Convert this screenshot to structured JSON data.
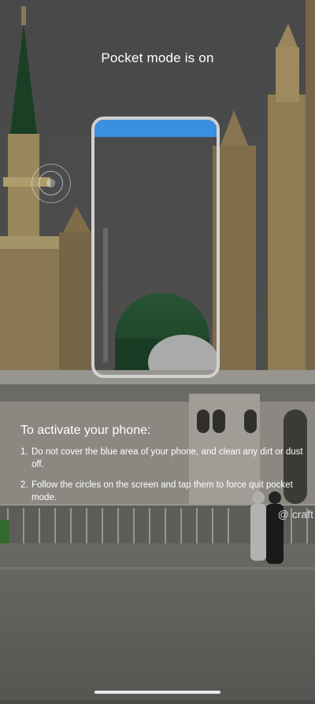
{
  "screen": {
    "title": "Pocket mode is on",
    "accent_color": "#3b8fe0",
    "frame_color": "#d2d2d2"
  },
  "instructions": {
    "heading": "To activate your phone:",
    "steps": [
      {
        "num": "1.",
        "text": "Do not cover the blue area of your phone, and clean any dirt or dust off."
      },
      {
        "num": "2.",
        "text": "Follow the circles on the screen and tap them to force quit pocket mode."
      }
    ]
  },
  "watermark": "@ craft",
  "icons": {
    "tap_target": "tap-circle-icon"
  }
}
